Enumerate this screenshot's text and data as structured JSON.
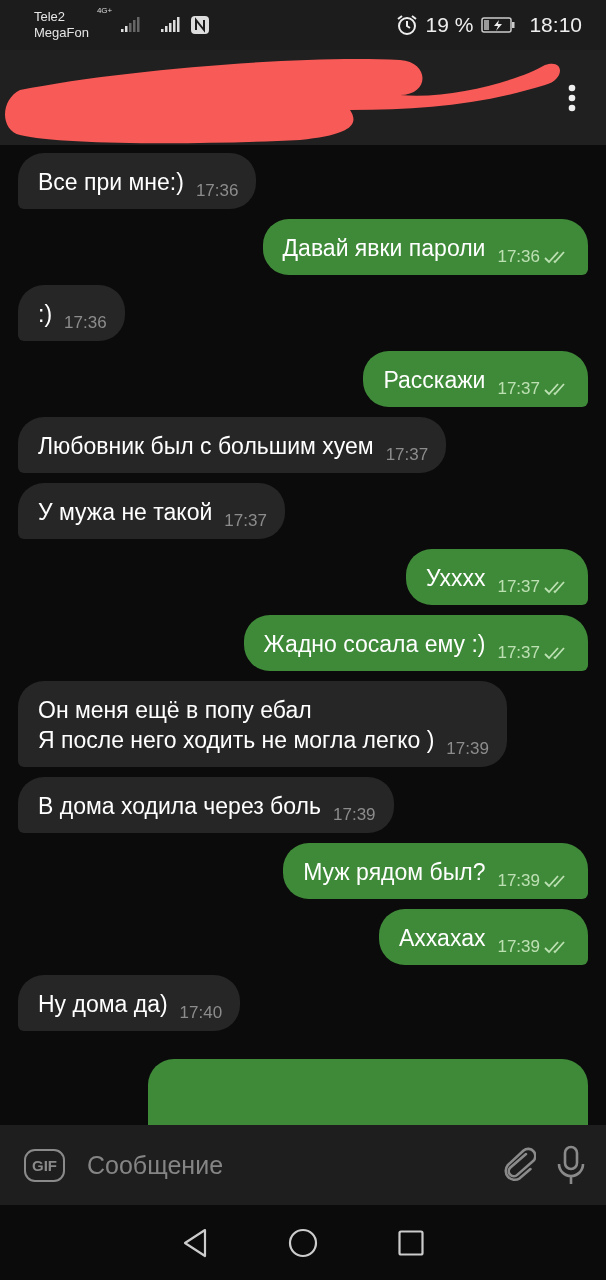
{
  "status_bar": {
    "carriers": [
      "Tele2",
      "MegaFon"
    ],
    "network_type": "4G+",
    "battery": "19 %",
    "time": "18:10"
  },
  "messages": [
    {
      "text": "Все при мне:)",
      "time": "17:36",
      "outgoing": false
    },
    {
      "text": "Давай явки пароли",
      "time": "17:36",
      "outgoing": true,
      "read": true
    },
    {
      "text": ":)",
      "time": "17:36",
      "outgoing": false
    },
    {
      "text": "Расскажи",
      "time": "17:37",
      "outgoing": true,
      "read": true
    },
    {
      "text": "Любовник был с большим хуем",
      "time": "17:37",
      "outgoing": false
    },
    {
      "text": "У мужа не такой",
      "time": "17:37",
      "outgoing": false
    },
    {
      "text": "Ухххх",
      "time": "17:37",
      "outgoing": true,
      "read": true
    },
    {
      "text": "Жадно сосала ему :)",
      "time": "17:37",
      "outgoing": true,
      "read": true
    },
    {
      "text": "Он меня ещё в попу ебал\nЯ после него ходить не могла легко )",
      "time": "17:39",
      "outgoing": false
    },
    {
      "text": "В дома ходила через боль",
      "time": "17:39",
      "outgoing": false
    },
    {
      "text": "Муж рядом был?",
      "time": "17:39",
      "outgoing": true,
      "read": true
    },
    {
      "text": "Аххахах",
      "time": "17:39",
      "outgoing": true,
      "read": true
    },
    {
      "text": "Ну дома да)",
      "time": "17:40",
      "outgoing": false
    },
    {
      "kind": "cut",
      "outgoing": true
    }
  ],
  "composer": {
    "gif": "GIF",
    "placeholder": "Сообщение"
  }
}
